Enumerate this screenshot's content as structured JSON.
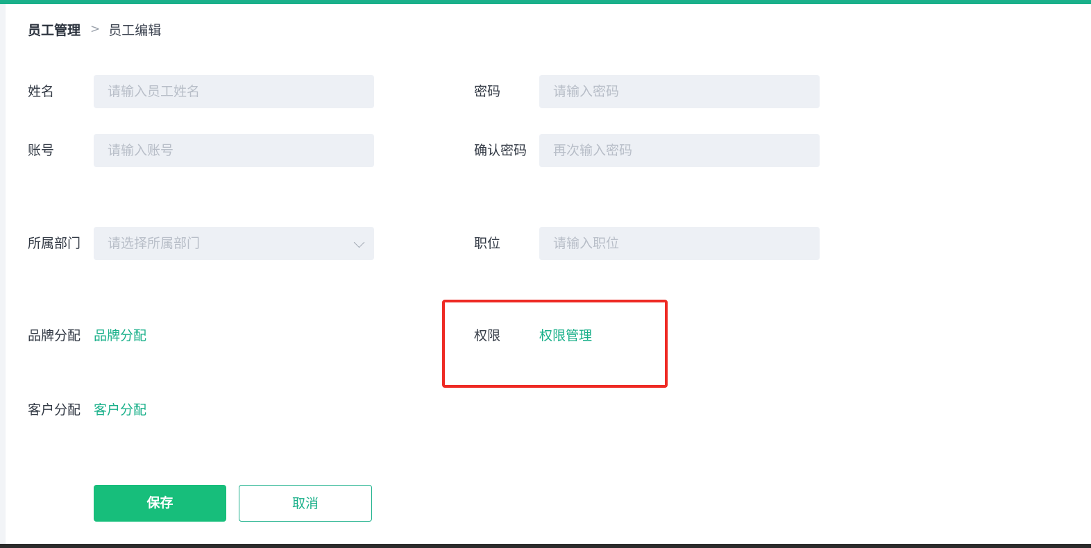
{
  "breadcrumb": {
    "root": "员工管理",
    "separator": ">",
    "current": "员工编辑"
  },
  "form": {
    "name": {
      "label": "姓名",
      "placeholder": "请输入员工姓名"
    },
    "password": {
      "label": "密码",
      "placeholder": "请输入密码"
    },
    "account": {
      "label": "账号",
      "placeholder": "请输入账号"
    },
    "confirm_password": {
      "label": "确认密码",
      "placeholder": "再次输入密码"
    },
    "department": {
      "label": "所属部门",
      "placeholder": "请选择所属部门"
    },
    "position": {
      "label": "职位",
      "placeholder": "请输入职位"
    },
    "brand_assign": {
      "label": "品牌分配",
      "link": "品牌分配"
    },
    "permission": {
      "label": "权限",
      "link": "权限管理"
    },
    "customer_assign": {
      "label": "客户分配",
      "link": "客户分配"
    }
  },
  "actions": {
    "save": "保存",
    "cancel": "取消"
  },
  "colors": {
    "accent": "#1ab08a",
    "primary_button": "#17be7b",
    "highlight_border": "#ee2a24",
    "input_bg": "#edf0f5"
  }
}
